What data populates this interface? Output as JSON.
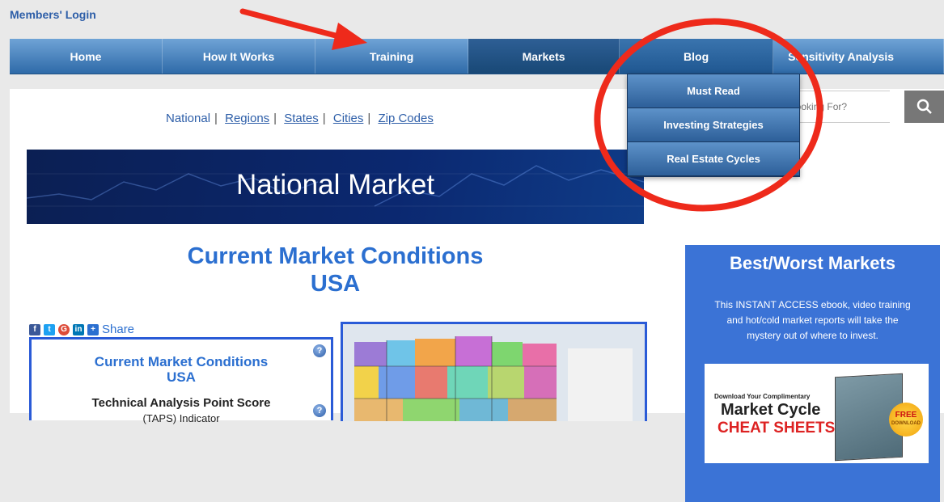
{
  "header": {
    "members_login": "Members' Login"
  },
  "nav": {
    "items": [
      {
        "label": "Home"
      },
      {
        "label": "How It Works"
      },
      {
        "label": "Training"
      },
      {
        "label": "Markets"
      },
      {
        "label": "Blog"
      },
      {
        "label": "Sensitivity Analysis"
      }
    ],
    "active": "Markets"
  },
  "dropdown": {
    "items": [
      "Must Read",
      "Investing Strategies",
      "Real Estate Cycles"
    ]
  },
  "subnav": {
    "items": [
      "National",
      "Regions",
      "States",
      "Cities",
      "Zip Codes"
    ],
    "separator": "|"
  },
  "banner": {
    "title": "National Market"
  },
  "main": {
    "title_line1": "Current Market Conditions",
    "title_line2": "USA"
  },
  "share": {
    "label": "Share",
    "icons": [
      "facebook-icon",
      "twitter-icon",
      "google-plus-icon",
      "linkedin-icon",
      "share-plus-icon"
    ]
  },
  "info_box": {
    "title_line1": "Current Market Conditions",
    "title_line2": "USA",
    "subtitle": "Technical Analysis Point Score",
    "subtitle2": "(TAPS) Indicator",
    "help_glyph": "?"
  },
  "search": {
    "placeholder": "Looking For?"
  },
  "sidebar": {
    "title": "Best/Worst Markets",
    "description": "This INSTANT ACCESS ebook, video training and hot/cold market reports will take the mystery out of where to invest.",
    "ad": {
      "line1": "Download Your Complimentary",
      "line2": "Market Cycle",
      "line3": "CHEAT SHEETS",
      "badge": "FREE",
      "badge_sub": "DOWNLOAD"
    }
  },
  "colors": {
    "nav_blue": "#2e6aa8",
    "link_blue": "#2d5ea8",
    "headline_blue": "#2b6fd0",
    "sidebar_blue": "#3b73d6",
    "annotation_red": "#ee2a1b"
  }
}
